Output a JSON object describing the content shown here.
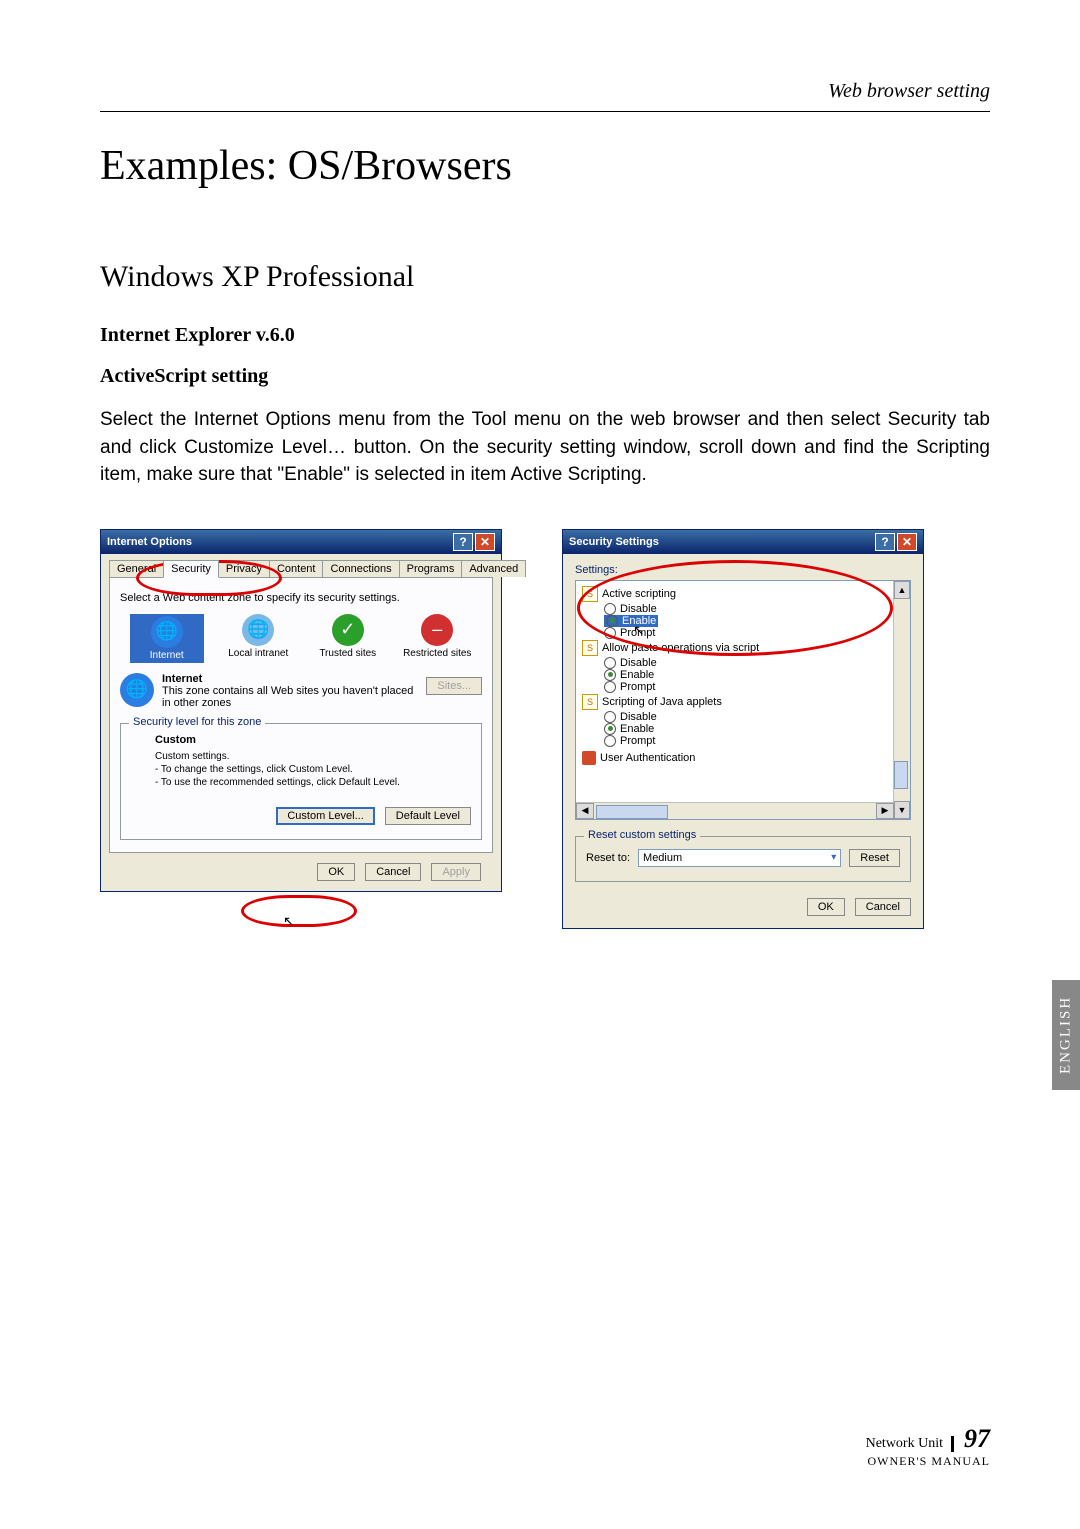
{
  "header": {
    "running": "Web browser setting"
  },
  "title": "Examples: OS/Browsers",
  "subtitle": "Windows XP Professional",
  "section1": "Internet Explorer v.6.0",
  "section2": "ActiveScript setting",
  "paragraph": "Select the Internet Options menu from the Tool menu on the web browser and then select Security tab and click Customize Level… button. On the security setting window, scroll down and find the Scripting item, make sure that \"Enable\" is selected in item Active Scripting.",
  "io": {
    "title": "Internet Options",
    "tabs": [
      "General",
      "Security",
      "Privacy",
      "Content",
      "Connections",
      "Programs",
      "Advanced"
    ],
    "active_tab": 1,
    "instruction": "Select a Web content zone to specify its security settings.",
    "zones": [
      "Internet",
      "Local intranet",
      "Trusted sites",
      "Restricted sites"
    ],
    "zone_heading": "Internet",
    "zone_desc": "This zone contains all Web sites you haven't placed in other zones",
    "sites_btn": "Sites...",
    "group_legend": "Security level for this zone",
    "level_name": "Custom",
    "level_sub": "Custom settings.",
    "level_line1": "- To change the settings, click Custom Level.",
    "level_line2": "- To use the recommended settings, click Default Level.",
    "custom_btn": "Custom Level...",
    "default_btn": "Default Level",
    "ok": "OK",
    "cancel": "Cancel",
    "apply": "Apply"
  },
  "ss": {
    "title": "Security Settings",
    "settings_label": "Settings:",
    "items": {
      "active_scripting": "Active scripting",
      "disable": "Disable",
      "enable": "Enable",
      "prompt": "Prompt",
      "allow_paste": "Allow paste operations via script",
      "java_applets": "Scripting of Java applets",
      "user_auth": "User Authentication"
    },
    "reset_legend": "Reset custom settings",
    "reset_to": "Reset to:",
    "reset_value": "Medium",
    "reset_btn": "Reset",
    "ok": "OK",
    "cancel": "Cancel"
  },
  "side_tab": "ENGLISH",
  "footer": {
    "unit": "Network Unit",
    "page": "97",
    "manual": "OWNER'S MANUAL"
  }
}
